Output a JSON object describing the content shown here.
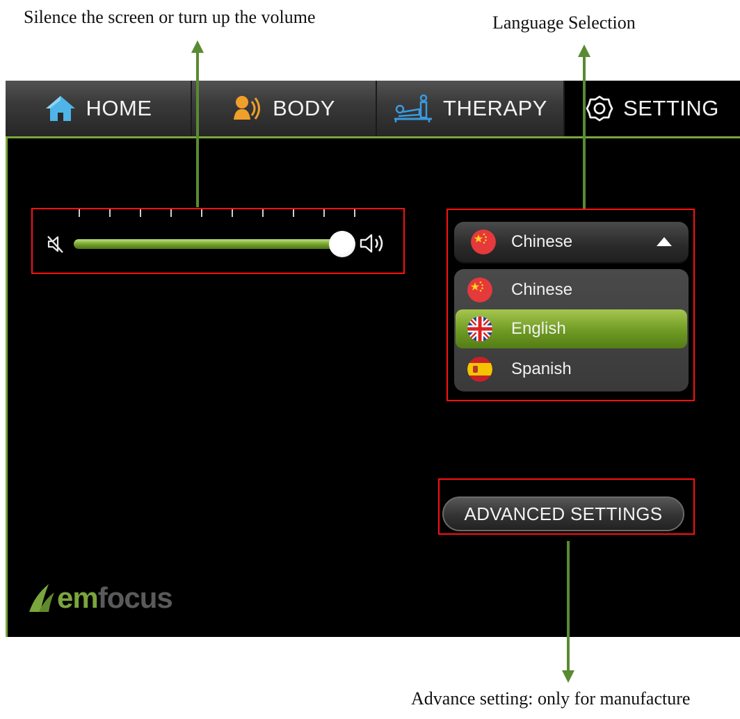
{
  "annotations": {
    "volume": "Silence the screen or turn up the volume",
    "language": "Language Selection",
    "advanced": "Advance setting: only for manufacture"
  },
  "tabs": [
    {
      "label": "HOME",
      "icon": "home-icon"
    },
    {
      "label": "BODY",
      "icon": "body-sound-icon"
    },
    {
      "label": "THERAPY",
      "icon": "therapy-bed-icon"
    },
    {
      "label": "SETTING",
      "icon": "gear-icon",
      "active": true
    }
  ],
  "volume": {
    "level": 1.0,
    "tick_count": 10
  },
  "language": {
    "selected": "Chinese",
    "options": [
      {
        "label": "Chinese",
        "flag": "china-flag-icon"
      },
      {
        "label": "English",
        "flag": "uk-flag-icon",
        "highlighted": true
      },
      {
        "label": "Spanish",
        "flag": "spain-flag-icon"
      }
    ]
  },
  "advanced_button": {
    "label": "ADVANCED SETTINGS"
  },
  "logo": {
    "em": "em",
    "rest": "focus"
  },
  "colors": {
    "accent_green": "#7aa63d",
    "highlight_red": "#ff1010",
    "arrow_green": "#5a8a32",
    "screen_bg": "#000000"
  }
}
